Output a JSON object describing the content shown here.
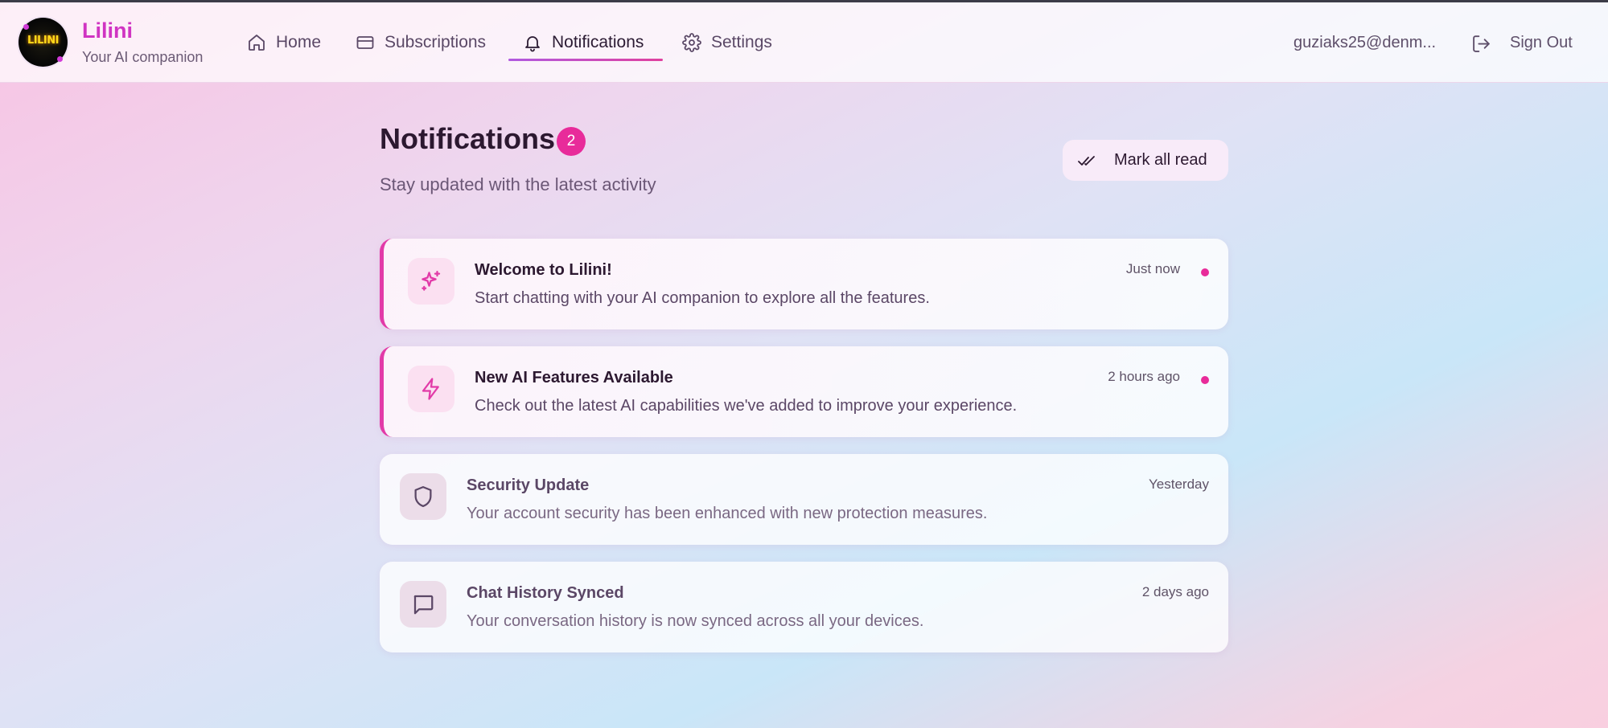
{
  "brand": {
    "name": "Lilini",
    "tagline": "Your AI companion",
    "logo_text": "LILINI"
  },
  "nav": {
    "items": [
      {
        "label": "Home",
        "icon": "home-icon"
      },
      {
        "label": "Subscriptions",
        "icon": "credit-card-icon"
      },
      {
        "label": "Notifications",
        "icon": "bell-icon",
        "active": true
      },
      {
        "label": "Settings",
        "icon": "gear-icon"
      }
    ]
  },
  "user": {
    "email": "guziaks25@denm...",
    "signout_label": "Sign Out"
  },
  "page": {
    "title": "Notifications",
    "unread_count": "2",
    "subtitle": "Stay updated with the latest activity",
    "mark_all_label": "Mark all read"
  },
  "notifications": [
    {
      "title": "Welcome to Lilini!",
      "message": "Start chatting with your AI companion to explore all the features.",
      "time": "Just now",
      "unread": true,
      "icon": "sparkles-icon"
    },
    {
      "title": "New AI Features Available",
      "message": "Check out the latest AI capabilities we've added to improve your experience.",
      "time": "2 hours ago",
      "unread": true,
      "icon": "lightning-icon"
    },
    {
      "title": "Security Update",
      "message": "Your account security has been enhanced with new protection measures.",
      "time": "Yesterday",
      "unread": false,
      "icon": "shield-icon"
    },
    {
      "title": "Chat History Synced",
      "message": "Your conversation history is now synced across all your devices.",
      "time": "2 days ago",
      "unread": false,
      "icon": "chat-bubble-icon"
    }
  ],
  "colors": {
    "accent": "#e82b9a",
    "brand": "#d034c2",
    "text_dark": "#2c1830"
  }
}
